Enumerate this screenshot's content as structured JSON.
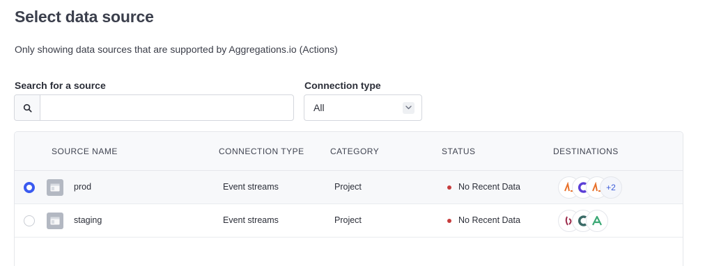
{
  "header": {
    "title": "Select data source",
    "subtitle": "Only showing data sources that are supported by Aggregations.io (Actions)"
  },
  "search": {
    "label": "Search for a source",
    "value": "",
    "placeholder": ""
  },
  "connection_filter": {
    "label": "Connection type",
    "selected": "All"
  },
  "table": {
    "columns": [
      "SOURCE NAME",
      "CONNECTION TYPE",
      "CATEGORY",
      "STATUS",
      "DESTINATIONS"
    ],
    "rows": [
      {
        "selected": true,
        "name": "prod",
        "connection_type": "Event streams",
        "category": "Project",
        "status": "No Recent Data",
        "destination_icons": [
          "amplitude-icon",
          "c-logo-icon",
          "amplitude-icon"
        ],
        "destinations_more": "+2"
      },
      {
        "selected": false,
        "name": "staging",
        "connection_type": "Event streams",
        "category": "Project",
        "status": "No Recent Data",
        "destination_icons": [
          "customerio-icon",
          "c-logo-icon",
          "arrow-a-icon"
        ],
        "destinations_more": ""
      }
    ]
  },
  "colors": {
    "accent": "#3a5af0",
    "status_dot": "#c63d3d",
    "amplitude": "#e8712a",
    "c_logo": "#5b3fd6",
    "customerio": "#9b2a4a",
    "arrow_a": "#3aa874"
  }
}
